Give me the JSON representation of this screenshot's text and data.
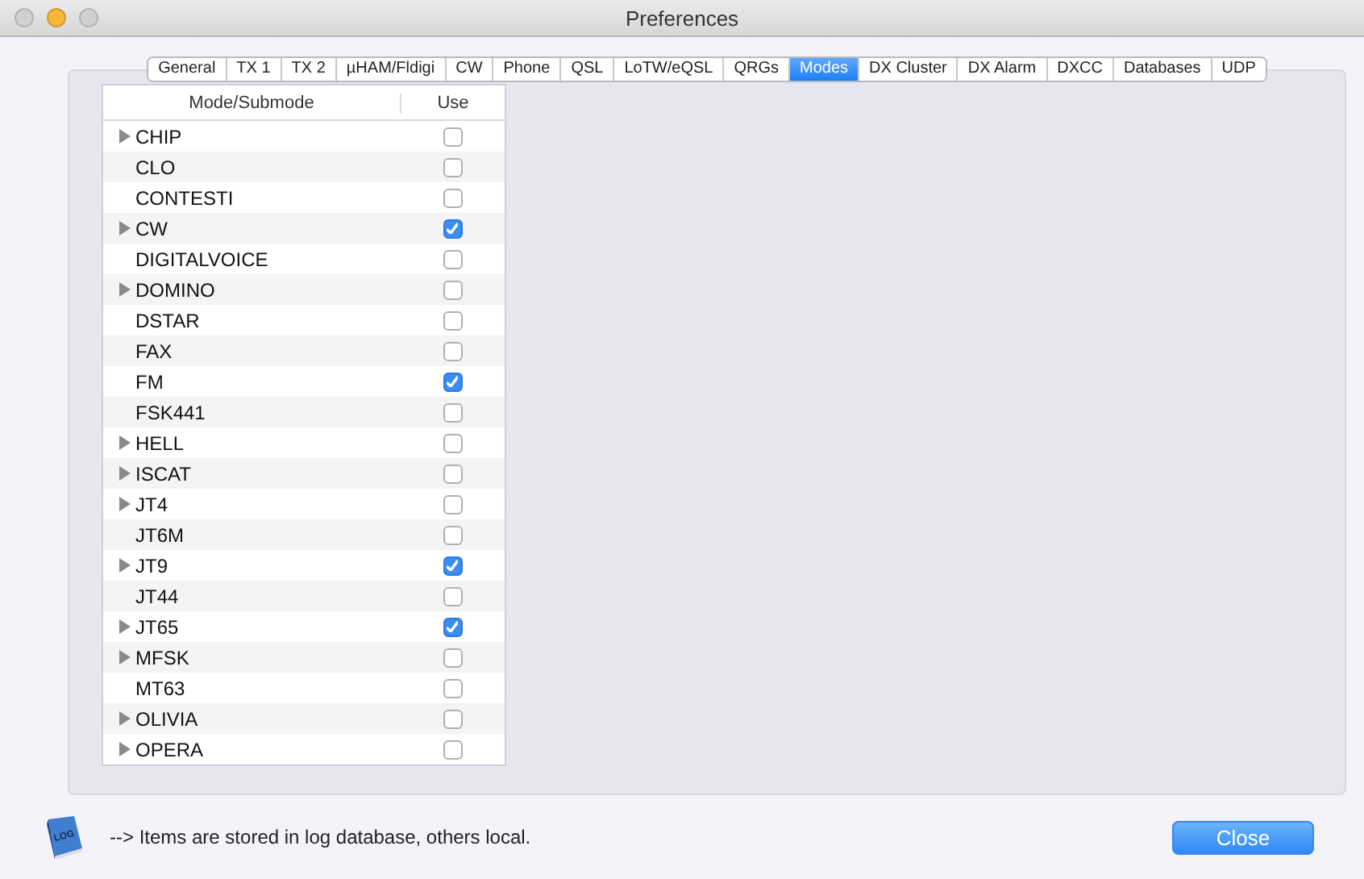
{
  "window": {
    "title": "Preferences"
  },
  "tabs": [
    {
      "label": "General",
      "selected": false
    },
    {
      "label": "TX 1",
      "selected": false
    },
    {
      "label": "TX 2",
      "selected": false
    },
    {
      "label": "µHAM/Fldigi",
      "selected": false
    },
    {
      "label": "CW",
      "selected": false
    },
    {
      "label": "Phone",
      "selected": false
    },
    {
      "label": "QSL",
      "selected": false
    },
    {
      "label": "LoTW/eQSL",
      "selected": false
    },
    {
      "label": "QRGs",
      "selected": false
    },
    {
      "label": "Modes",
      "selected": true
    },
    {
      "label": "DX Cluster",
      "selected": false
    },
    {
      "label": "DX Alarm",
      "selected": false
    },
    {
      "label": "DXCC",
      "selected": false
    },
    {
      "label": "Databases",
      "selected": false
    },
    {
      "label": "UDP",
      "selected": false
    }
  ],
  "table": {
    "columns": [
      "Mode/Submode",
      "Use"
    ],
    "rows": [
      {
        "mode": "CHIP",
        "expandable": true,
        "checked": false
      },
      {
        "mode": "CLO",
        "expandable": false,
        "checked": false
      },
      {
        "mode": "CONTESTI",
        "expandable": false,
        "checked": false
      },
      {
        "mode": "CW",
        "expandable": true,
        "checked": true
      },
      {
        "mode": "DIGITALVOICE",
        "expandable": false,
        "checked": false
      },
      {
        "mode": "DOMINO",
        "expandable": true,
        "checked": false
      },
      {
        "mode": "DSTAR",
        "expandable": false,
        "checked": false
      },
      {
        "mode": "FAX",
        "expandable": false,
        "checked": false
      },
      {
        "mode": "FM",
        "expandable": false,
        "checked": true
      },
      {
        "mode": "FSK441",
        "expandable": false,
        "checked": false
      },
      {
        "mode": "HELL",
        "expandable": true,
        "checked": false
      },
      {
        "mode": "ISCAT",
        "expandable": true,
        "checked": false
      },
      {
        "mode": "JT4",
        "expandable": true,
        "checked": false
      },
      {
        "mode": "JT6M",
        "expandable": false,
        "checked": false
      },
      {
        "mode": "JT9",
        "expandable": true,
        "checked": true
      },
      {
        "mode": "JT44",
        "expandable": false,
        "checked": false
      },
      {
        "mode": "JT65",
        "expandable": true,
        "checked": true
      },
      {
        "mode": "MFSK",
        "expandable": true,
        "checked": false
      },
      {
        "mode": "MT63",
        "expandable": false,
        "checked": false
      },
      {
        "mode": "OLIVIA",
        "expandable": true,
        "checked": false
      },
      {
        "mode": "OPERA",
        "expandable": true,
        "checked": false
      }
    ]
  },
  "footer": {
    "icon_label": "LOG",
    "note": "--> Items are stored in log database, others local.",
    "button": "Close"
  }
}
